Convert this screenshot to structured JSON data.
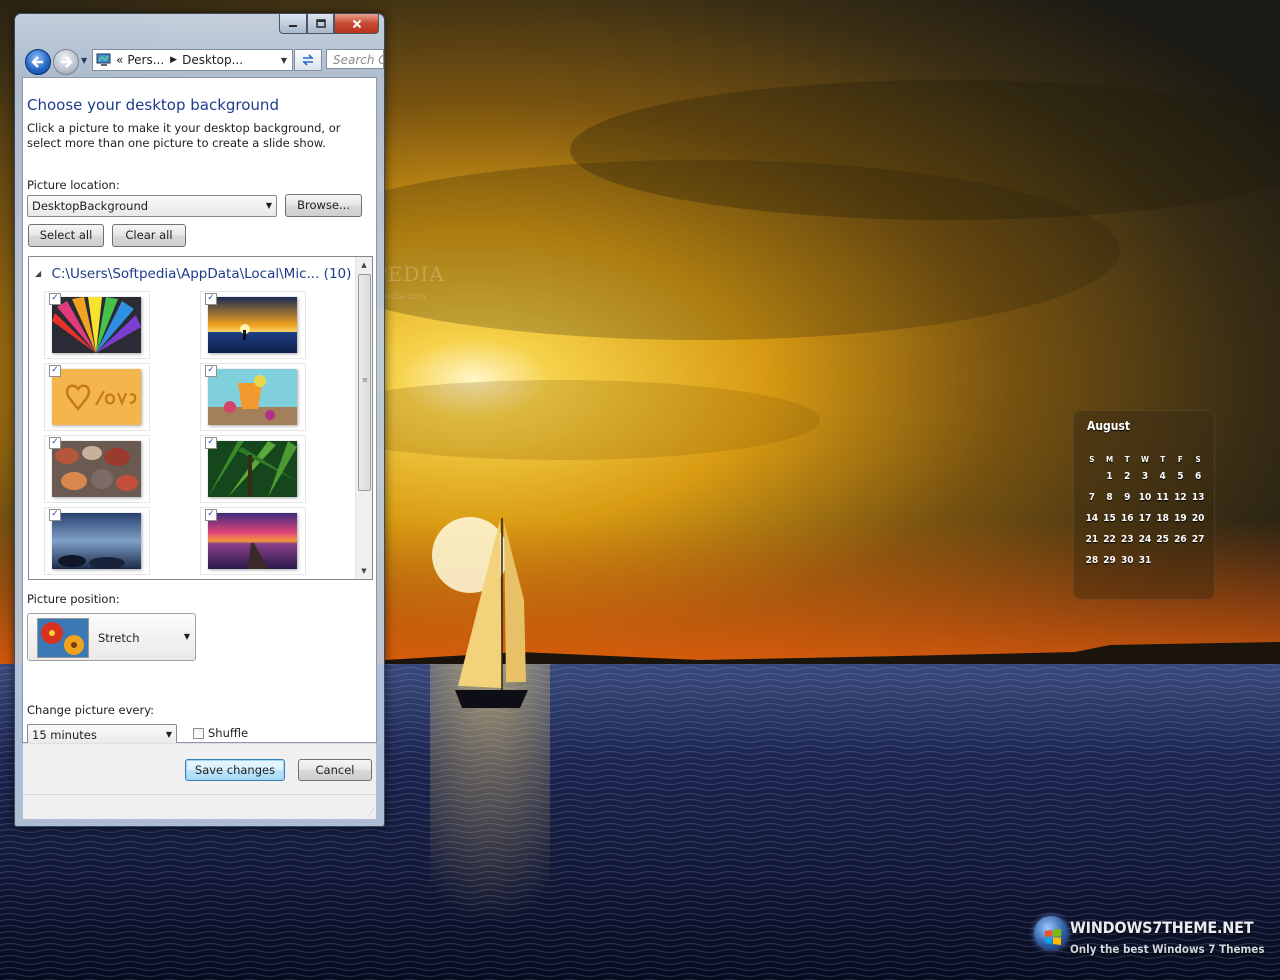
{
  "window": {
    "address": {
      "segments": [
        "Pers...",
        "Desktop..."
      ],
      "overflow": "«"
    },
    "search_placeholder": "Search C"
  },
  "page": {
    "title": "Choose your desktop background",
    "description": "Click a picture to make it your desktop background, or select more than one picture to create a slide show.",
    "picture_location_label": "Picture location:",
    "picture_location_value": "DesktopBackground",
    "browse_label": "Browse...",
    "select_all_label": "Select all",
    "clear_all_label": "Clear all",
    "group": {
      "path": "C:\\Users\\Softpedia\\AppData\\Local\\Mic...",
      "count": "(10)"
    },
    "pictures": [
      {
        "name": "colored-flower",
        "checked": true
      },
      {
        "name": "sunset-pier",
        "checked": true
      },
      {
        "name": "love-in-sand",
        "checked": true
      },
      {
        "name": "tropical-drink",
        "checked": true
      },
      {
        "name": "wet-pebbles",
        "checked": true
      },
      {
        "name": "jungle-leaves",
        "checked": true
      },
      {
        "name": "blue-rocks-shore",
        "checked": true
      },
      {
        "name": "pink-sunset-jetty",
        "checked": true
      }
    ],
    "picture_position_label": "Picture position:",
    "picture_position_value": "Stretch",
    "change_every_label": "Change picture every:",
    "change_every_value": "15 minutes",
    "shuffle_label": "Shuffle",
    "shuffle_checked": false,
    "save_label": "Save changes",
    "cancel_label": "Cancel"
  },
  "desktop": {
    "watermark": "SOFTPEDIA",
    "watermark_url": "www.softpedia.com",
    "calendar": {
      "month": "August",
      "weekdays": [
        "S",
        "M",
        "T",
        "W",
        "T",
        "F",
        "S"
      ],
      "weeks": [
        [
          "",
          "1",
          "2",
          "3",
          "4",
          "5",
          "6"
        ],
        [
          "7",
          "8",
          "9",
          "10",
          "11",
          "12",
          "13"
        ],
        [
          "14",
          "15",
          "16",
          "17",
          "18",
          "19",
          "20"
        ],
        [
          "21",
          "22",
          "23",
          "24",
          "25",
          "26",
          "27"
        ],
        [
          "28",
          "29",
          "30",
          "31",
          "",
          "",
          ""
        ]
      ]
    },
    "brand": {
      "title": "WINDOWS7THEME.NET",
      "tagline": "Only the best Windows 7 Themes"
    }
  },
  "colors": {
    "link_blue": "#1d3c8a",
    "accent": "#3c7fb1",
    "close_red": "#c74a32"
  }
}
